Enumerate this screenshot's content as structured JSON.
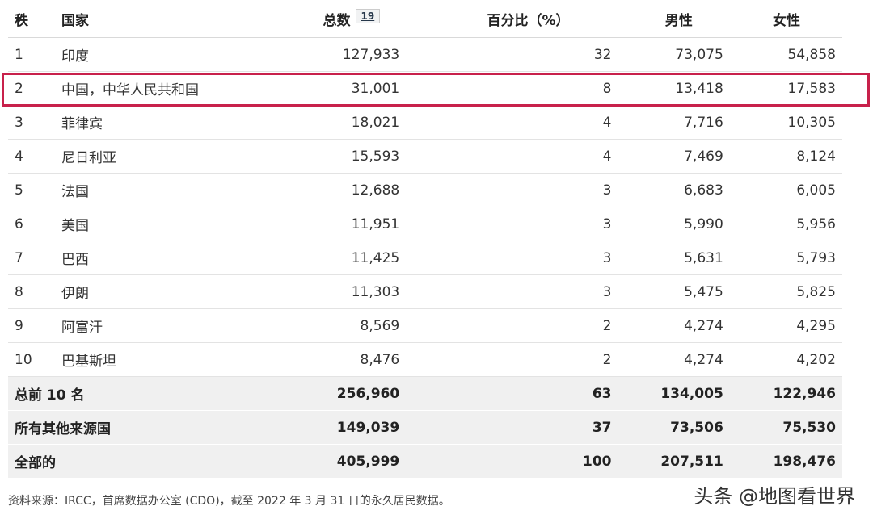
{
  "headers": {
    "rank": "秩",
    "country": "国家",
    "total": "总数",
    "footnote": "19",
    "percent": "百分比（%）",
    "male": "男性",
    "female": "女性"
  },
  "rows": [
    {
      "rank": "1",
      "country": "印度",
      "total": "127,933",
      "percent": "32",
      "male": "73,075",
      "female": "54,858"
    },
    {
      "rank": "2",
      "country": "中国，中华人民共和国",
      "total": "31,001",
      "percent": "8",
      "male": "13,418",
      "female": "17,583"
    },
    {
      "rank": "3",
      "country": "菲律宾",
      "total": "18,021",
      "percent": "4",
      "male": "7,716",
      "female": "10,305"
    },
    {
      "rank": "4",
      "country": "尼日利亚",
      "total": "15,593",
      "percent": "4",
      "male": "7,469",
      "female": "8,124"
    },
    {
      "rank": "5",
      "country": "法国",
      "total": "12,688",
      "percent": "3",
      "male": "6,683",
      "female": "6,005"
    },
    {
      "rank": "6",
      "country": "美国",
      "total": "11,951",
      "percent": "3",
      "male": "5,990",
      "female": "5,956"
    },
    {
      "rank": "7",
      "country": "巴西",
      "total": "11,425",
      "percent": "3",
      "male": "5,631",
      "female": "5,793"
    },
    {
      "rank": "8",
      "country": "伊朗",
      "total": "11,303",
      "percent": "3",
      "male": "5,475",
      "female": "5,825"
    },
    {
      "rank": "9",
      "country": "阿富汗",
      "total": "8,569",
      "percent": "2",
      "male": "4,274",
      "female": "4,295"
    },
    {
      "rank": "10",
      "country": "巴基斯坦",
      "total": "8,476",
      "percent": "2",
      "male": "4,274",
      "female": "4,202"
    }
  ],
  "summary": [
    {
      "label": "总前 10 名",
      "total": "256,960",
      "percent": "63",
      "male": "134,005",
      "female": "122,946"
    },
    {
      "label": "所有其他来源国",
      "total": "149,039",
      "percent": "37",
      "male": "73,506",
      "female": "75,530"
    },
    {
      "label": "全部的",
      "total": "405,999",
      "percent": "100",
      "male": "207,511",
      "female": "198,476"
    }
  ],
  "source": "资料来源：IRCC，首席数据办公室 (CDO)，截至 2022 年 3 月 31 日的永久居民数据。",
  "watermark": "头条 @地图看世界",
  "colors": {
    "highlight": "#c8214b",
    "summary_bg": "#f0f0f0"
  }
}
